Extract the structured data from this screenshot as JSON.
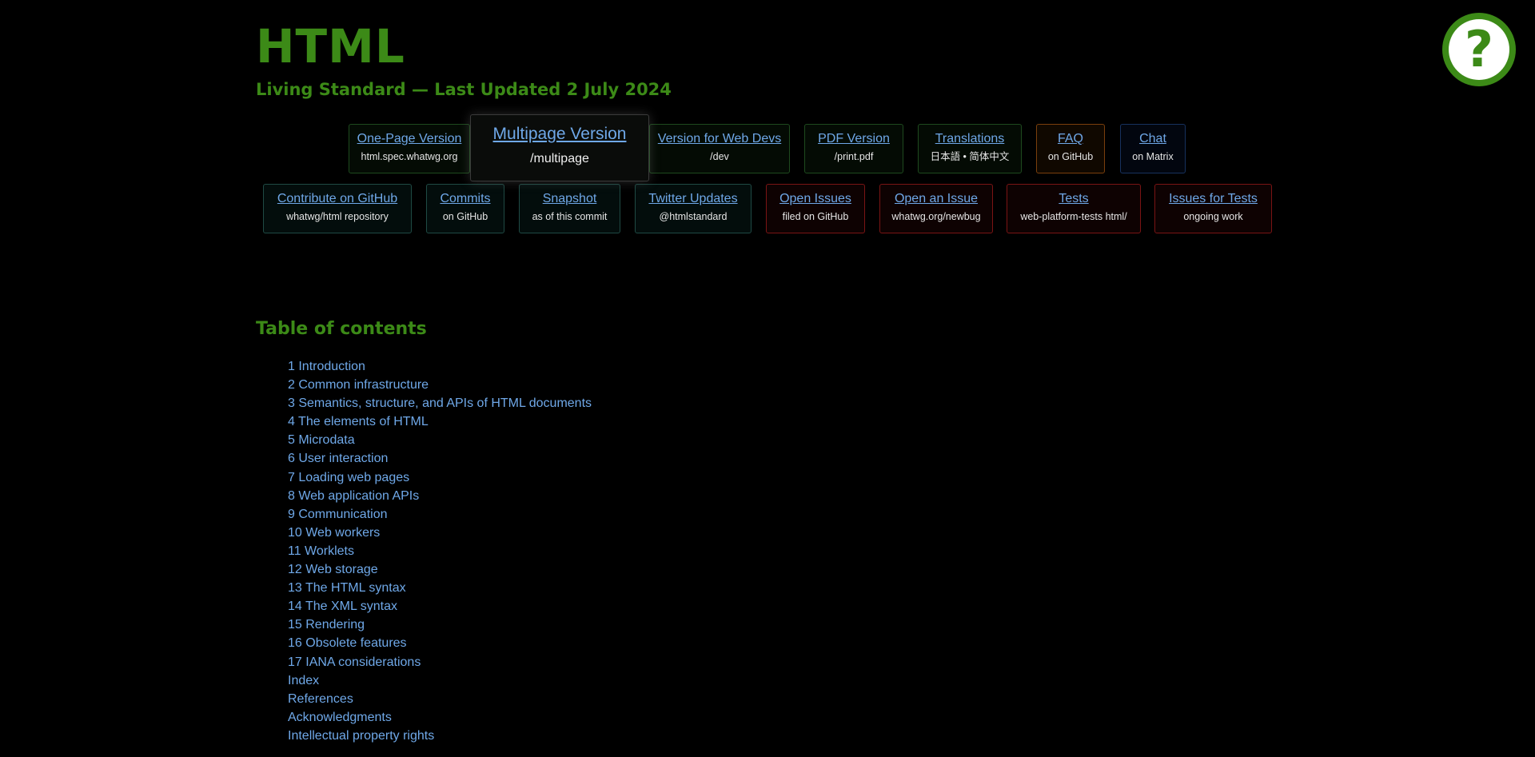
{
  "header": {
    "title": "HTML",
    "subtitle": "Living Standard — Last Updated 2 July 2024",
    "help_icon": "question-mark-icon",
    "help_glyph": "?"
  },
  "nav_row_1": [
    {
      "label": "One-Page Version",
      "sub": "html.spec.whatwg.org",
      "color": "green"
    },
    {
      "label": "Multipage Version",
      "sub": "/multipage",
      "color": "neutral",
      "featured": true
    },
    {
      "label": "Version for Web Devs",
      "sub": "/dev",
      "color": "green"
    },
    {
      "label": "PDF Version",
      "sub": "/print.pdf",
      "color": "green"
    },
    {
      "label": "Translations",
      "sub": "日本語 • 简体中文",
      "color": "green"
    },
    {
      "label": "FAQ",
      "sub": "on GitHub",
      "color": "orange"
    },
    {
      "label": "Chat",
      "sub": "on Matrix",
      "color": "blue"
    }
  ],
  "nav_row_2": [
    {
      "label": "Contribute on GitHub",
      "sub": "whatwg/html repository",
      "color": "teal"
    },
    {
      "label": "Commits",
      "sub": "on GitHub",
      "color": "teal"
    },
    {
      "label": "Snapshot",
      "sub": "as of this commit",
      "color": "teal"
    },
    {
      "label": "Twitter Updates",
      "sub": "@htmlstandard",
      "color": "teal"
    },
    {
      "label": "Open Issues",
      "sub": "filed on GitHub",
      "color": "red"
    },
    {
      "label": "Open an Issue",
      "sub": "whatwg.org/newbug",
      "color": "red"
    },
    {
      "label": "Tests",
      "sub": "web-platform-tests html/",
      "color": "red"
    },
    {
      "label": "Issues for Tests",
      "sub": "ongoing work",
      "color": "red"
    }
  ],
  "toc": {
    "heading": "Table of contents",
    "items": [
      "1 Introduction",
      "2 Common infrastructure",
      "3 Semantics, structure, and APIs of HTML documents",
      "4 The elements of HTML",
      "5 Microdata",
      "6 User interaction",
      "7 Loading web pages",
      "8 Web application APIs",
      "9 Communication",
      "10 Web workers",
      "11 Worklets",
      "12 Web storage",
      "13 The HTML syntax",
      "14 The XML syntax",
      "15 Rendering",
      "16 Obsolete features",
      "17 IANA considerations",
      "Index",
      "References",
      "Acknowledgments",
      "Intellectual property rights"
    ]
  },
  "colors": {
    "accent_green": "#3c8a17",
    "link_blue": "#6fa8e8",
    "background": "#000000"
  }
}
